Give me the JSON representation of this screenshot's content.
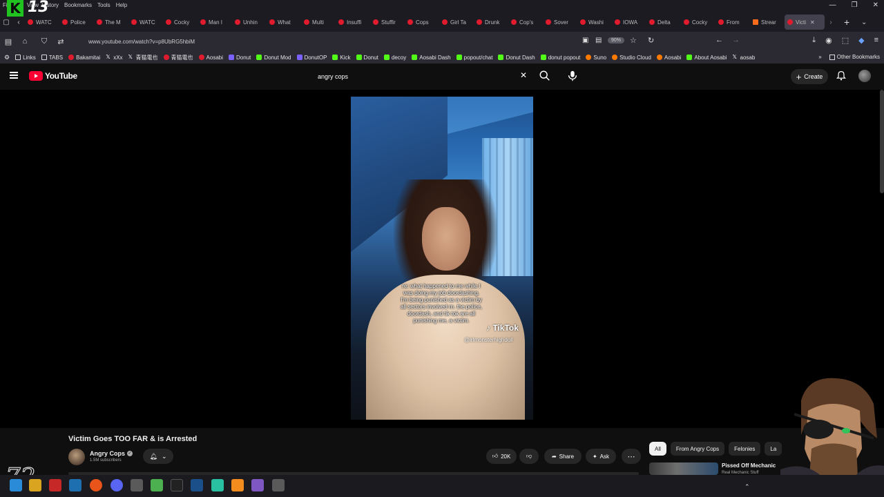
{
  "menubar": {
    "items": [
      "File",
      "View",
      "History",
      "Bookmarks",
      "Tools",
      "Help"
    ],
    "logo_letter": "K",
    "logo_number": "13"
  },
  "tabs": [
    {
      "label": "WATC",
      "icon": "youtube-icon"
    },
    {
      "label": "Police",
      "icon": "youtube-icon"
    },
    {
      "label": "The M",
      "icon": "youtube-icon"
    },
    {
      "label": "WATC",
      "icon": "youtube-icon"
    },
    {
      "label": "Cocky",
      "icon": "youtube-icon"
    },
    {
      "label": "Man I",
      "icon": "youtube-icon"
    },
    {
      "label": "Unhin",
      "icon": "youtube-icon"
    },
    {
      "label": "What",
      "icon": "youtube-icon"
    },
    {
      "label": "Multi",
      "icon": "youtube-icon"
    },
    {
      "label": "Insuffi",
      "icon": "youtube-icon"
    },
    {
      "label": "Stuffir",
      "icon": "youtube-icon"
    },
    {
      "label": "Cops",
      "icon": "youtube-icon"
    },
    {
      "label": "Girl Ta",
      "icon": "youtube-icon"
    },
    {
      "label": "Drunk",
      "icon": "youtube-icon"
    },
    {
      "label": "Cop's",
      "icon": "youtube-icon"
    },
    {
      "label": "Sover",
      "icon": "youtube-icon"
    },
    {
      "label": "Washi",
      "icon": "youtube-icon"
    },
    {
      "label": "IOWA",
      "icon": "youtube-icon"
    },
    {
      "label": "Delta",
      "icon": "youtube-icon"
    },
    {
      "label": "Cocky",
      "icon": "youtube-icon"
    },
    {
      "label": "From",
      "icon": "youtube-icon"
    },
    {
      "label": "Strear",
      "icon": "stream-icon"
    },
    {
      "label": "Victi",
      "icon": "youtube-icon",
      "active": true
    }
  ],
  "navbar": {
    "url": "www.youtube.com/watch?v=p8UbRG5hbiM",
    "zoom": "90%"
  },
  "bookmarks": [
    {
      "label": "Links",
      "icon": "folder"
    },
    {
      "label": "TABS",
      "icon": "folder"
    },
    {
      "label": "Bakamitai",
      "icon": "red"
    },
    {
      "label": "xXx",
      "icon": "x"
    },
    {
      "label": "青猫電也",
      "icon": "x"
    },
    {
      "label": "青猫電也",
      "icon": "red"
    },
    {
      "label": "Aosabi",
      "icon": "red"
    },
    {
      "label": "Donut",
      "icon": "purple"
    },
    {
      "label": "Donut Mod",
      "icon": "green"
    },
    {
      "label": "DonutOP",
      "icon": "purple"
    },
    {
      "label": "Kick",
      "icon": "green"
    },
    {
      "label": "Donut",
      "icon": "green"
    },
    {
      "label": "decoy",
      "icon": "green"
    },
    {
      "label": "Aosabi Dash",
      "icon": "green"
    },
    {
      "label": "popout/chat",
      "icon": "green"
    },
    {
      "label": "Donut Dash",
      "icon": "green"
    },
    {
      "label": "donut popout",
      "icon": "green"
    },
    {
      "label": "Suno",
      "icon": "orange"
    },
    {
      "label": "Studio Cloud",
      "icon": "orange"
    },
    {
      "label": "Aosabi",
      "icon": "orange"
    },
    {
      "label": "About Aosabi",
      "icon": "green"
    },
    {
      "label": "aosab",
      "icon": "x"
    }
  ],
  "other_bookmarks": "Other Bookmarks",
  "youtube": {
    "logo_text": "YouTube",
    "search_value": "angry cops",
    "create_label": "Create"
  },
  "video": {
    "caption": "re: what happened to me while I was doing my job doordashing. I'm being punished as a victim by all sectors involved rn. the police, doordash, and tik tok are all punishing me, a victim.",
    "tiktok_logo": "TikTok",
    "tiktok_handle": "@irlmonsterhighdoll",
    "title": "Victim Goes TOO FAR & is Arrested"
  },
  "channel": {
    "name": "Angry Cops",
    "subscribers": "1.5M subscribers"
  },
  "actions": {
    "likes": "20K",
    "share_label": "Share",
    "ask_label": "Ask"
  },
  "chips": [
    "All",
    "From Angry Cops",
    "Felonies",
    "La"
  ],
  "recommended": {
    "title": "Pissed Off Mechanic",
    "channel": "Real Mechanic Stuff"
  },
  "corner_logo": "72"
}
